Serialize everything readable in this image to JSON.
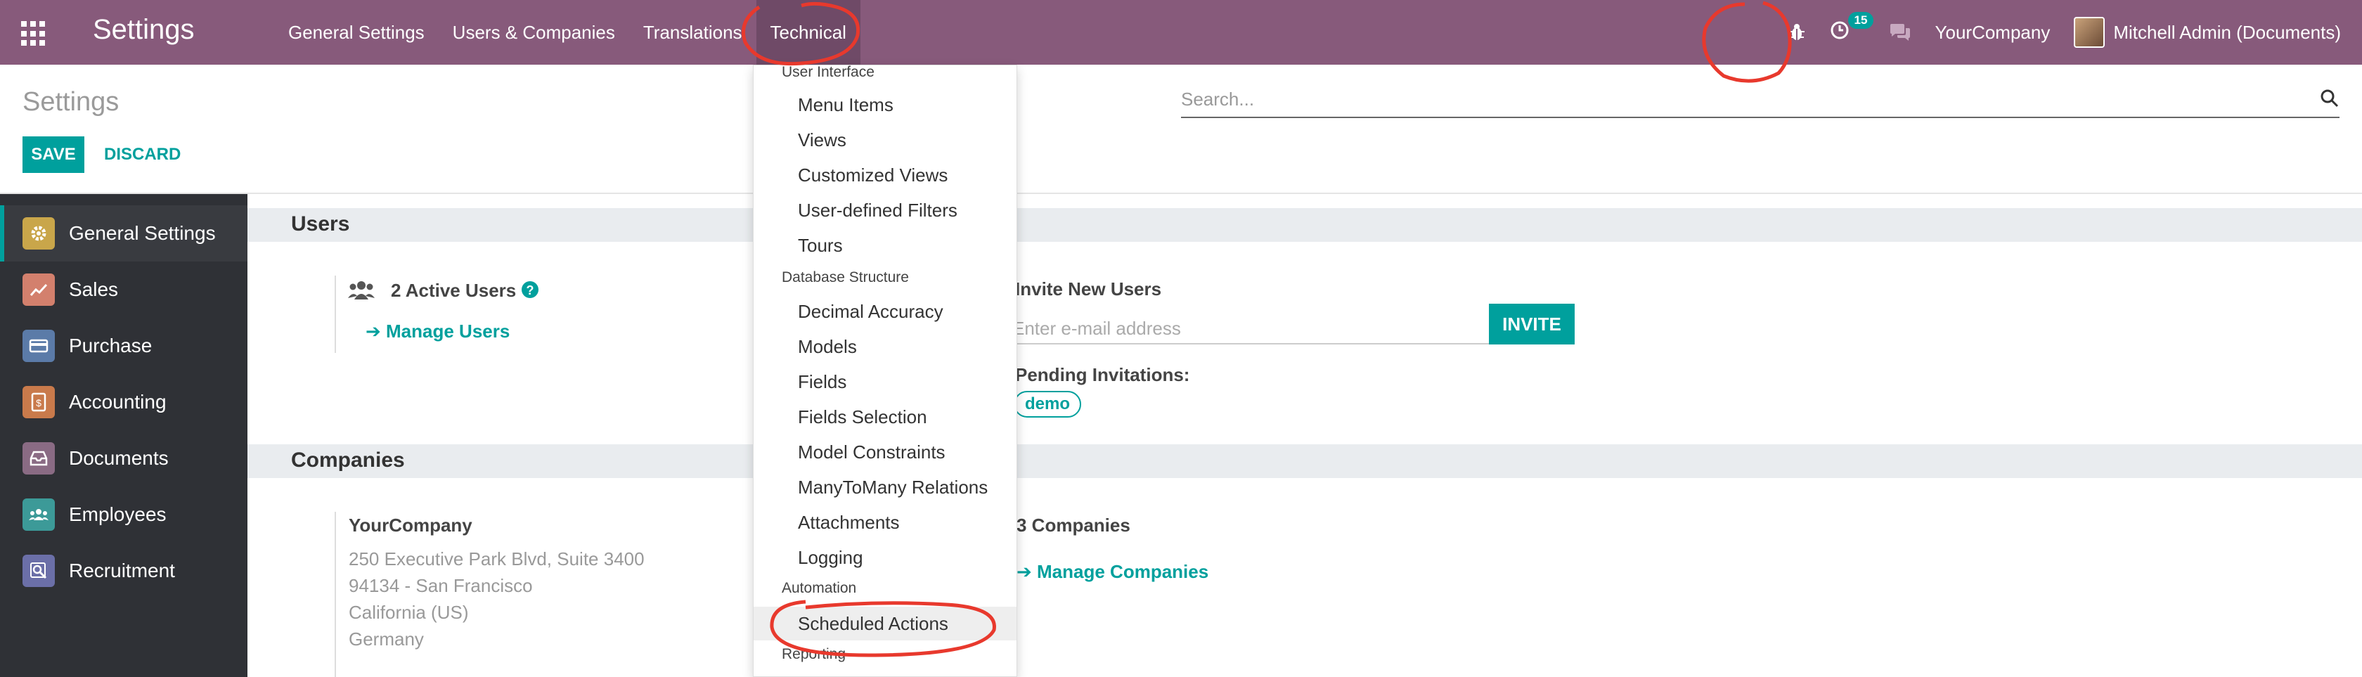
{
  "navbar": {
    "brand": "Settings",
    "menu": [
      "General Settings",
      "Users & Companies",
      "Translations",
      "Technical"
    ],
    "activity_count": "15",
    "company": "YourCompany",
    "user": "Mitchell Admin (Documents)"
  },
  "control_panel": {
    "title": "Settings",
    "save_label": "SAVE",
    "discard_label": "DISCARD",
    "search_placeholder": "Search..."
  },
  "sidebar": {
    "items": [
      {
        "label": "General Settings",
        "icon": "gear-icon",
        "color": "#c9a64a"
      },
      {
        "label": "Sales",
        "icon": "chart-icon",
        "color": "#d3806d"
      },
      {
        "label": "Purchase",
        "icon": "card-icon",
        "color": "#5b7ba8"
      },
      {
        "label": "Accounting",
        "icon": "dollar-icon",
        "color": "#c97a4b"
      },
      {
        "label": "Documents",
        "icon": "inbox-icon",
        "color": "#8a6b84"
      },
      {
        "label": "Employees",
        "icon": "people-icon",
        "color": "#3c9a98"
      },
      {
        "label": "Recruitment",
        "icon": "search-doc-icon",
        "color": "#6b6fa8"
      }
    ]
  },
  "users_section": {
    "title": "Users",
    "active_users": "2 Active Users",
    "manage_users": "Manage Users",
    "invite_title": "Invite New Users",
    "invite_placeholder": "Enter e-mail address",
    "invite_button": "INVITE",
    "pending_title": "Pending Invitations:",
    "pending_tag": "demo"
  },
  "companies_section": {
    "title": "Companies",
    "company_name": "YourCompany",
    "address": [
      "250 Executive Park Blvd, Suite 3400",
      "94134 - San Francisco",
      "California (US)",
      "Germany"
    ],
    "companies_count": "3 Companies",
    "manage_companies": "Manage Companies"
  },
  "technical_menu": {
    "header_user_interface": "User Interface",
    "user_interface": [
      "Menu Items",
      "Views",
      "Customized Views",
      "User-defined Filters",
      "Tours"
    ],
    "header_database": "Database Structure",
    "database": [
      "Decimal Accuracy",
      "Models",
      "Fields",
      "Fields Selection",
      "Model Constraints",
      "ManyToMany Relations",
      "Attachments",
      "Logging"
    ],
    "header_automation": "Automation",
    "automation": [
      "Scheduled Actions"
    ],
    "header_reporting": "Reporting"
  }
}
